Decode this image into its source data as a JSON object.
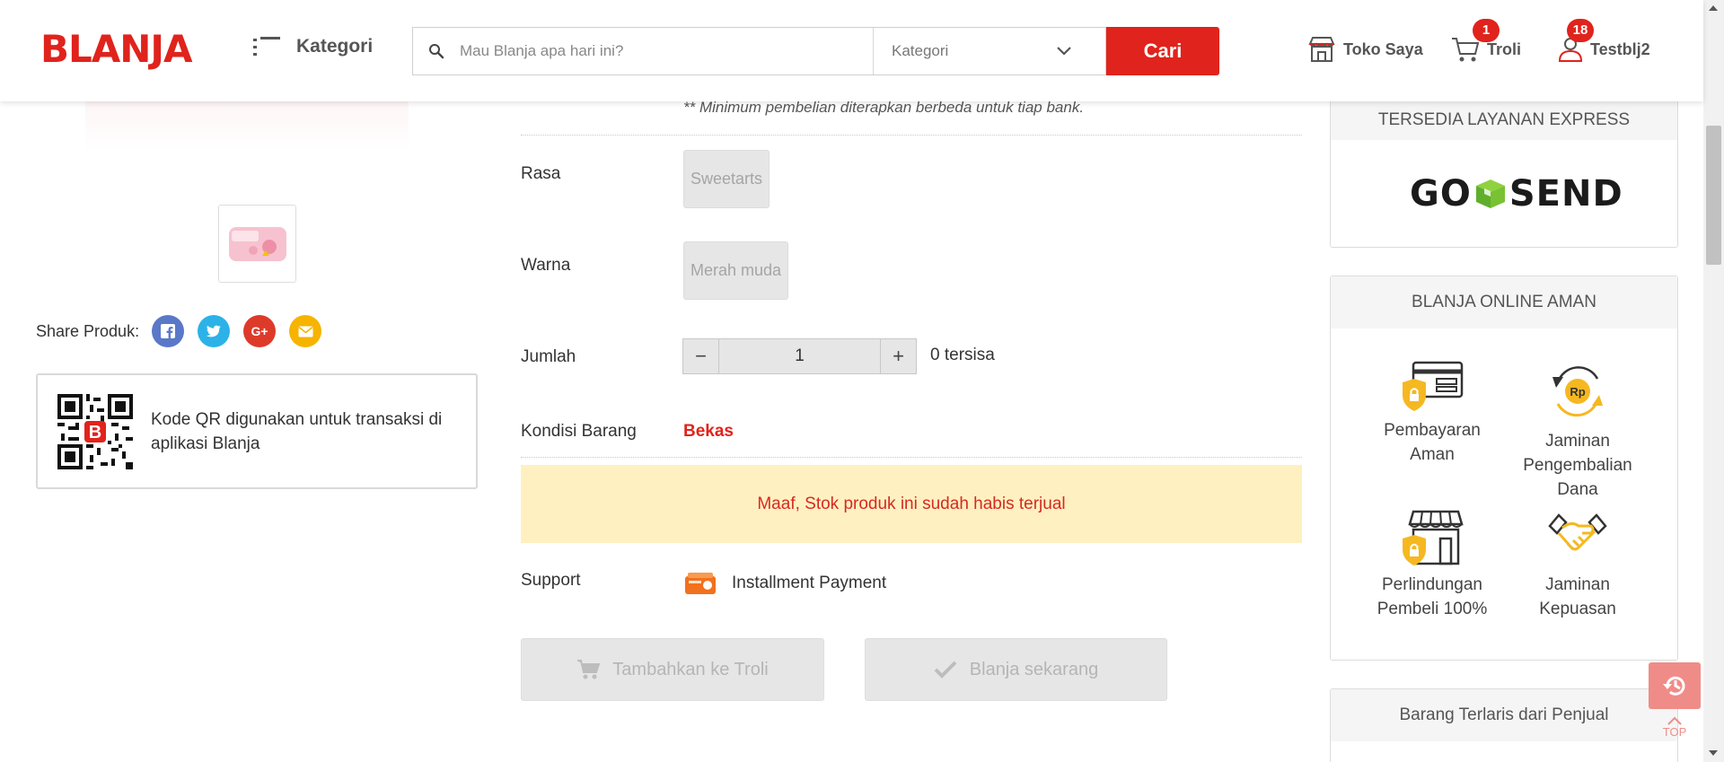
{
  "header": {
    "logo": "BLANJA",
    "kategori_label": "Kategori",
    "search_placeholder": "Mau Blanja apa hari ini?",
    "category_select": "Kategori",
    "search_button": "Cari",
    "toko_label": "Toko Saya",
    "troli_label": "Troli",
    "troli_count": "1",
    "user_label": "Testblj2",
    "user_count": "18"
  },
  "left": {
    "share_label": "Share Produk:",
    "share_buttons": [
      {
        "name": "facebook",
        "glyph": "f",
        "color": "#5a78c8"
      },
      {
        "name": "twitter",
        "glyph": "t",
        "color": "#2cb2e8"
      },
      {
        "name": "google-plus",
        "glyph": "G+",
        "color": "#dd3a2a"
      },
      {
        "name": "email",
        "glyph": "✉",
        "color": "#f6b400"
      }
    ],
    "qr_text": "Kode QR digunakan untuk transaksi di aplikasi Blanja",
    "qr_badge": "B"
  },
  "product": {
    "bank_note": "** Minimum pembelian diterapkan berbeda untuk tiap bank.",
    "rasa_label": "Rasa",
    "rasa_value": "Sweetarts",
    "warna_label": "Warna",
    "warna_value": "Merah muda",
    "jumlah_label": "Jumlah",
    "quantity": "1",
    "minus": "−",
    "plus": "+",
    "stock_left": "0 tersisa",
    "kondisi_label": "Kondisi Barang",
    "kondisi_value": "Bekas",
    "alert": "Maaf, Stok produk ini sudah habis terjual",
    "support_label": "Support",
    "support_value": "Installment Payment",
    "add_to_cart": "Tambahkan ke Troli",
    "buy_now": "Blanja sekarang"
  },
  "sidebar": {
    "express_title": "TERSEDIA LAYANAN EXPRESS",
    "gosend_go": "GO",
    "gosend_send": "SEND",
    "aman_title": "BLANJA ONLINE AMAN",
    "features": [
      {
        "label": "Pembayaran Aman",
        "icon": "card-shield-icon"
      },
      {
        "label": "Jaminan Pengembalian Dana",
        "icon": "refund-icon"
      },
      {
        "label": "Perlindungan Pembeli 100%",
        "icon": "store-shield-icon"
      },
      {
        "label": "Jaminan Kepuasan",
        "icon": "handshake-icon"
      }
    ],
    "refund_rp": "Rp",
    "terlaris_title": "Barang Terlaris dari Penjual"
  },
  "floating": {
    "top_label": "TOP"
  },
  "colors": {
    "brand_red": "#e0231c",
    "alert_bg": "#fff0c1",
    "gold": "#f5b820"
  }
}
